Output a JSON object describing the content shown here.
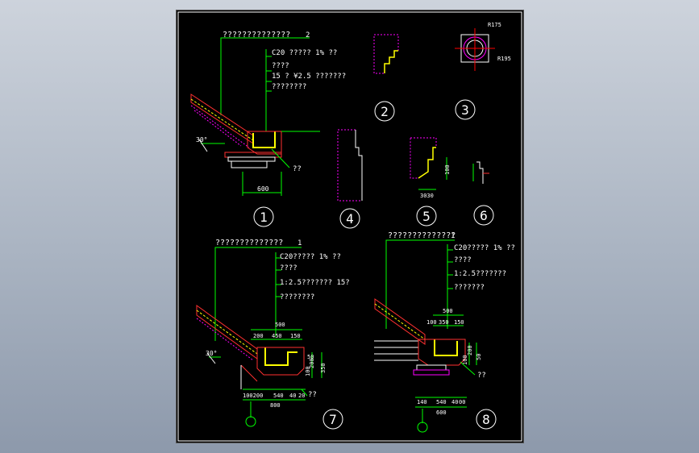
{
  "colors": {
    "background": "#000000",
    "frame": "#ffffff",
    "leader": "#00ff00",
    "gutter": "#ffff00",
    "hatch": "#ff00ff",
    "dimension": "#00ff00",
    "text": "#ffffff",
    "roof": "#ff3030",
    "axis": "#ff0000",
    "paper_outer": "#a7b1bf"
  },
  "detail1": {
    "callout": "??????????????",
    "callout_num": "2",
    "layers": [
      "C20 ?????  1% ??",
      "????",
      "15 ?  ¥2.5 ???????",
      "????????"
    ],
    "angle": "30°",
    "gutter_note": "??",
    "dim_width": "600",
    "number": "1"
  },
  "detail2": {
    "number": "2"
  },
  "detail3": {
    "radius_top": "R175",
    "radius_bottom": "R195",
    "number": "3"
  },
  "detail4": {
    "number": "4"
  },
  "detail5": {
    "dim_vertical": "100",
    "dim_bottom": "3030",
    "number": "5"
  },
  "detail6": {
    "number": "6"
  },
  "detail7": {
    "callout": "??????????????",
    "callout_num": "1",
    "layers": [
      "C20?????   1% ??",
      "????",
      "1:2.5???????    15?",
      "????????"
    ],
    "angle": "30°",
    "dims_top": [
      "500",
      "200",
      "450",
      "150"
    ],
    "dims_side": [
      "100",
      "200",
      "350",
      "50"
    ],
    "dims_bottom": [
      "100200",
      "540",
      "40",
      "20",
      "800"
    ],
    "gutter_note": "??",
    "number": "7"
  },
  "detail8": {
    "callout": "??????????????",
    "callout_num": "1",
    "layers": [
      "C20?????   1% ??",
      "????",
      "1:2.5???????",
      "???????"
    ],
    "dims_top": [
      "500",
      "100",
      "350",
      "150"
    ],
    "dims_side": [
      "100",
      "200",
      "50"
    ],
    "dims_bottom": [
      "140",
      "540",
      "40",
      "00",
      "600"
    ],
    "gutter_note": "??",
    "number": "8"
  }
}
